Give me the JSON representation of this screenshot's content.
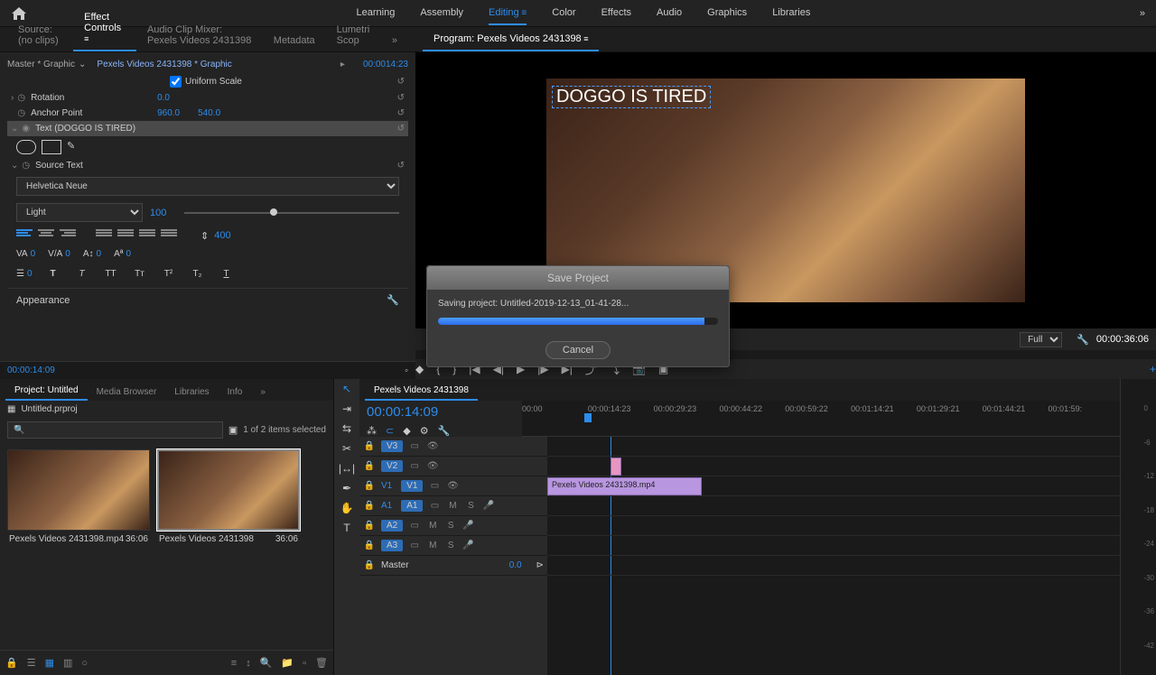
{
  "topbar": {
    "workspaces": [
      "Learning",
      "Assembly",
      "Editing",
      "Color",
      "Effects",
      "Audio",
      "Graphics",
      "Libraries"
    ],
    "active": "Editing"
  },
  "sourceTabs": {
    "items": [
      "Source: (no clips)",
      "Effect Controls",
      "Audio Clip Mixer: Pexels Videos 2431398",
      "Metadata",
      "Lumetri Scop"
    ],
    "active": "Effect Controls"
  },
  "programTab": "Program: Pexels Videos 2431398",
  "effectControls": {
    "master": "Master * Graphic",
    "program": "Pexels Videos 2431398 * Graphic",
    "uniformScale": "Uniform Scale",
    "rotation": {
      "label": "Rotation",
      "value": "0.0"
    },
    "anchor": {
      "label": "Anchor Point",
      "x": "960.0",
      "y": "540.0"
    },
    "textItem": "Text (DOGGO IS TIRED)",
    "sourceText": "Source Text",
    "font": "Helvetica Neue",
    "weight": "Light",
    "size": "100",
    "leading": "400",
    "kerning": "0",
    "tracking": "0",
    "baseline": "0",
    "tsume": "0",
    "scaleW": "0",
    "appearance": "Appearance",
    "time": "00:00:14:09",
    "timeRuler": "00:0014:23"
  },
  "monitor": {
    "titleText": "DOGGO IS TIRED",
    "zoom": "Full",
    "duration": "00:00:36:06"
  },
  "project": {
    "tabs": [
      "Project: Untitled",
      "Media Browser",
      "Libraries",
      "Info"
    ],
    "activeTab": "Project: Untitled",
    "projName": "Untitled.prproj",
    "itemCount": "1 of 2 items selected",
    "items": [
      {
        "name": "Pexels Videos 2431398.mp4",
        "dur": "36:06",
        "selected": false
      },
      {
        "name": "Pexels Videos 2431398",
        "dur": "36:06",
        "selected": true
      }
    ]
  },
  "timeline": {
    "tab": "Pexels Videos 2431398",
    "time": "00:00:14:09",
    "ticks": [
      "00:00",
      "00:00:14:23",
      "00:00:29:23",
      "00:00:44:22",
      "00:00:59:22",
      "00:01:14:21",
      "00:01:29:21",
      "00:01:44:21",
      "00:01:59:"
    ],
    "tracks": {
      "video": [
        "V3",
        "V2",
        "V1"
      ],
      "audio": [
        "A1",
        "A2",
        "A3"
      ],
      "master": "Master",
      "masterVal": "0.0"
    },
    "clip": "Pexels Videos 2431398.mp4",
    "muteLabel": "M",
    "soloLabel": "S"
  },
  "modal": {
    "title": "Save Project",
    "message": "Saving project: Untitled-2019-12-13_01-41-28...",
    "cancel": "Cancel"
  },
  "meter": [
    "0",
    "-6",
    "-12",
    "-18",
    "-24",
    "-30",
    "-36",
    "-42"
  ]
}
